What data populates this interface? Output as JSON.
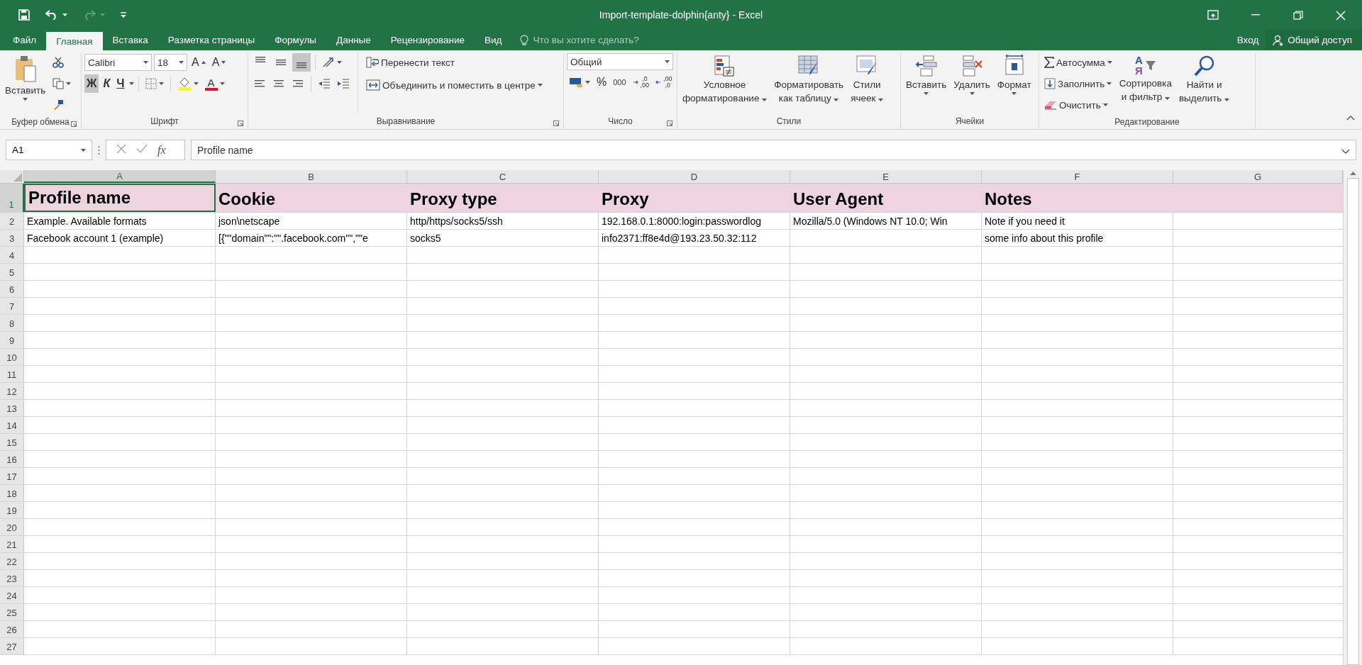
{
  "window": {
    "title": "Import-template-dolphin{anty} - Excel"
  },
  "tabs": [
    {
      "label": "Файл",
      "selected": false
    },
    {
      "label": "Главная",
      "selected": true
    },
    {
      "label": "Вставка",
      "selected": false
    },
    {
      "label": "Разметка страницы",
      "selected": false
    },
    {
      "label": "Формулы",
      "selected": false
    },
    {
      "label": "Данные",
      "selected": false
    },
    {
      "label": "Рецензирование",
      "selected": false
    },
    {
      "label": "Вид",
      "selected": false
    }
  ],
  "tell_me": {
    "placeholder": "Что вы хотите сделать?"
  },
  "sign_in": "Вход",
  "share": "Общий доступ",
  "ribbon": {
    "groups": [
      {
        "kind": "clipboard",
        "label": "Буфер обмена",
        "paste": "Вставить"
      },
      {
        "kind": "font",
        "label": "Шрифт",
        "font_name": "Calibri",
        "font_size": "18",
        "grow": "A",
        "shrink": "A",
        "font_color": "A",
        "styles": [
          {
            "kind": "bold",
            "label": "Ж",
            "selected": true
          },
          {
            "kind": "italic",
            "label": "К",
            "selected": false
          },
          {
            "kind": "underline",
            "label": "Ч",
            "selected": false
          }
        ]
      },
      {
        "kind": "alignment",
        "label": "Выравнивание",
        "wrap": "Перенести текст",
        "merge": "Объединить и поместить в центре",
        "vertical": [
          {
            "kind": "top",
            "selected": false
          },
          {
            "kind": "middle",
            "selected": false
          },
          {
            "kind": "bottom",
            "selected": true
          }
        ]
      },
      {
        "kind": "number",
        "label": "Число",
        "format": "Общий",
        "percent": "%",
        "thousands": "000",
        "more_decimals": [
          ",0",
          ",00"
        ],
        "fewer_decimals": [
          ",00",
          ",0"
        ]
      },
      {
        "kind": "styles",
        "label": "Стили",
        "buttons": [
          {
            "kind": "conditional",
            "lines": [
              "Условное",
              "форматирование"
            ]
          },
          {
            "kind": "table",
            "lines": [
              "Форматировать",
              "как таблицу"
            ]
          },
          {
            "kind": "cellstyles",
            "lines": [
              "Стили",
              "ячеек"
            ]
          }
        ]
      },
      {
        "kind": "cells",
        "label": "Ячейки",
        "buttons": [
          {
            "kind": "insert",
            "label": "Вставить"
          },
          {
            "kind": "delete",
            "label": "Удалить"
          },
          {
            "kind": "format",
            "label": "Формат"
          }
        ]
      },
      {
        "kind": "editing",
        "label": "Редактирование",
        "autosum": "Автосумма",
        "fill": "Заполнить",
        "clear": "Очистить",
        "sort": [
          "Сортировка",
          "и фильтр"
        ],
        "sort_letters": [
          "А",
          "Я"
        ],
        "find": [
          "Найти и",
          "выделить"
        ]
      }
    ]
  },
  "formula_bar": {
    "name_box": "A1",
    "function_label": "fx",
    "formula": "Profile name"
  },
  "sheet": {
    "columns": [
      {
        "letter": "A",
        "selected": true
      },
      {
        "letter": "B",
        "selected": false
      },
      {
        "letter": "C",
        "selected": false
      },
      {
        "letter": "D",
        "selected": false
      },
      {
        "letter": "E",
        "selected": false
      },
      {
        "letter": "F",
        "selected": false
      },
      {
        "letter": "G",
        "selected": false
      }
    ],
    "rows": [
      {
        "number": "1",
        "kind": "heading",
        "selected": true,
        "cells": [
          "Profile name",
          "Cookie",
          "Proxy type",
          "Proxy",
          "User Agent",
          "Notes"
        ]
      },
      {
        "number": "2",
        "kind": "plain",
        "selected": false,
        "cells": [
          "Example. Available formats",
          "json\\netscape",
          "http/https/socks5/ssh",
          "192.168.0.1:8000:login:passwordlog",
          "Mozilla/5.0 (Windows NT 10.0; Win",
          "Note if you need it"
        ]
      },
      {
        "number": "3",
        "kind": "plain",
        "selected": false,
        "cells": [
          "Facebook account 1 (example)",
          "[{\"\"domain\"\":\"\".facebook.com\"\",\"\"e",
          "socks5",
          "info2371:ff8e4d@193.23.50.32:112",
          null,
          "some info about this profile"
        ]
      },
      {
        "number": "4",
        "kind": "plain",
        "selected": false
      },
      {
        "number": "5",
        "kind": "plain",
        "selected": false
      },
      {
        "number": "6",
        "kind": "plain",
        "selected": false
      },
      {
        "number": "7",
        "kind": "plain",
        "selected": false
      },
      {
        "number": "8",
        "kind": "plain",
        "selected": false
      },
      {
        "number": "9",
        "kind": "plain",
        "selected": false
      },
      {
        "number": "10",
        "kind": "plain",
        "selected": false
      },
      {
        "number": "11",
        "kind": "plain",
        "selected": false
      },
      {
        "number": "12",
        "kind": "plain",
        "selected": false
      },
      {
        "number": "13",
        "kind": "plain",
        "selected": false
      },
      {
        "number": "14",
        "kind": "plain",
        "selected": false
      },
      {
        "number": "15",
        "kind": "plain",
        "selected": false
      },
      {
        "number": "16",
        "kind": "plain",
        "selected": false
      },
      {
        "number": "17",
        "kind": "plain",
        "selected": false
      },
      {
        "number": "18",
        "kind": "plain",
        "selected": false
      },
      {
        "number": "19",
        "kind": "plain",
        "selected": false
      },
      {
        "number": "20",
        "kind": "plain",
        "selected": false
      },
      {
        "number": "21",
        "kind": "plain",
        "selected": false
      },
      {
        "number": "22",
        "kind": "plain",
        "selected": false
      },
      {
        "number": "23",
        "kind": "plain",
        "selected": false
      },
      {
        "number": "24",
        "kind": "plain",
        "selected": false
      },
      {
        "number": "25",
        "kind": "plain",
        "selected": false
      },
      {
        "number": "26",
        "kind": "plain",
        "selected": false
      },
      {
        "number": "27",
        "kind": "plain",
        "selected": false
      }
    ]
  }
}
